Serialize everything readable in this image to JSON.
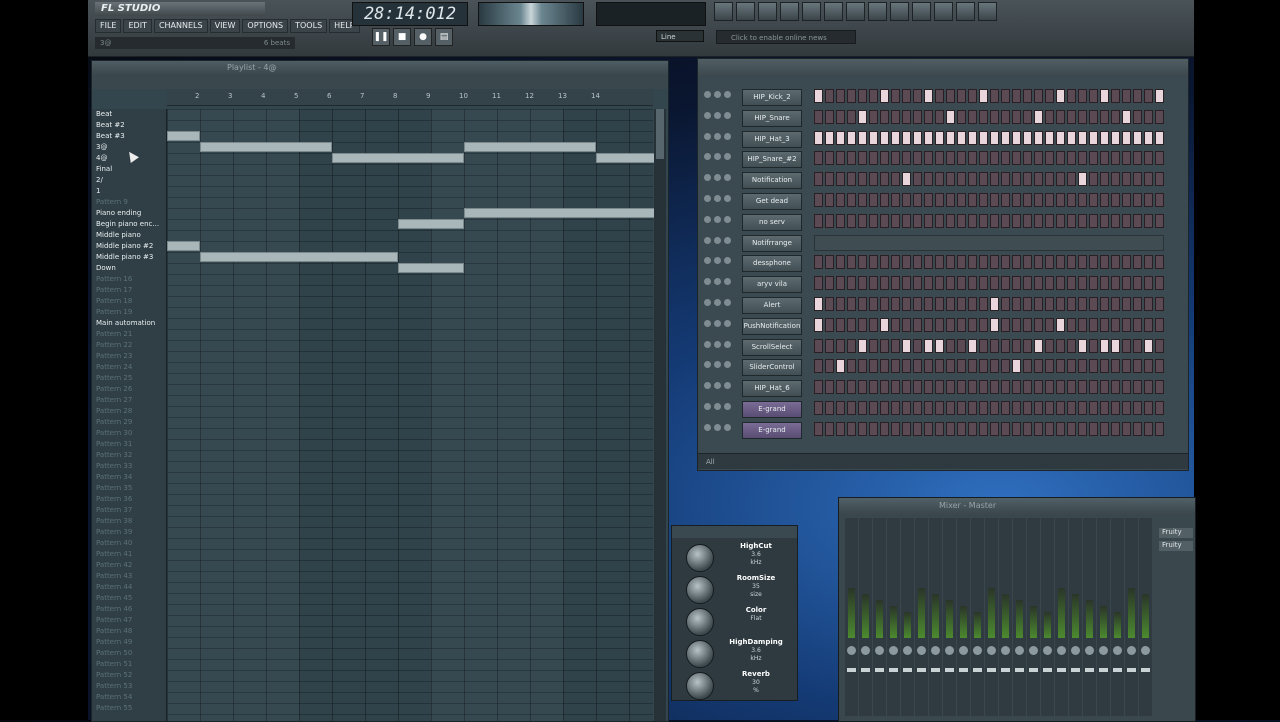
{
  "app": {
    "title": "FL STUDIO",
    "hint": "3@",
    "hint_right": "6 beats"
  },
  "menu": [
    "FILE",
    "EDIT",
    "CHANNELS",
    "VIEW",
    "OPTIONS",
    "TOOLS",
    "HELP"
  ],
  "time_display": "28:14:012",
  "news_text": "Click to enable online news",
  "line_label": "Line",
  "playlist": {
    "title": "Playlist - 4@",
    "ruler": [
      "2",
      "3",
      "4",
      "5",
      "6",
      "7",
      "8",
      "9",
      "10",
      "11",
      "12",
      "13",
      "14"
    ],
    "tracks": [
      {
        "label": "Beat",
        "named": true
      },
      {
        "label": "Beat #2",
        "named": true
      },
      {
        "label": "Beat #3",
        "named": true
      },
      {
        "label": "3@",
        "named": true
      },
      {
        "label": "4@",
        "named": true
      },
      {
        "label": "Final",
        "named": true
      },
      {
        "label": "2/",
        "named": true
      },
      {
        "label": "1",
        "named": true
      },
      {
        "label": "Pattern 9",
        "named": false
      },
      {
        "label": "Piano ending",
        "named": true
      },
      {
        "label": "Begin piano enc...",
        "named": true
      },
      {
        "label": "Middle piano",
        "named": true
      },
      {
        "label": "Middle piano #2",
        "named": true
      },
      {
        "label": "Middle piano #3",
        "named": true
      },
      {
        "label": "Down",
        "named": true
      },
      {
        "label": "Pattern 16",
        "named": false
      },
      {
        "label": "Pattern 17",
        "named": false
      },
      {
        "label": "Pattern 18",
        "named": false
      },
      {
        "label": "Pattern 19",
        "named": false
      },
      {
        "label": "Main automation",
        "named": true
      },
      {
        "label": "Pattern 21",
        "named": false
      },
      {
        "label": "Pattern 22",
        "named": false
      },
      {
        "label": "Pattern 23",
        "named": false
      },
      {
        "label": "Pattern 24",
        "named": false
      },
      {
        "label": "Pattern 25",
        "named": false
      },
      {
        "label": "Pattern 26",
        "named": false
      },
      {
        "label": "Pattern 27",
        "named": false
      },
      {
        "label": "Pattern 28",
        "named": false
      },
      {
        "label": "Pattern 29",
        "named": false
      },
      {
        "label": "Pattern 30",
        "named": false
      },
      {
        "label": "Pattern 31",
        "named": false
      },
      {
        "label": "Pattern 32",
        "named": false
      },
      {
        "label": "Pattern 33",
        "named": false
      },
      {
        "label": "Pattern 34",
        "named": false
      },
      {
        "label": "Pattern 35",
        "named": false
      },
      {
        "label": "Pattern 36",
        "named": false
      },
      {
        "label": "Pattern 37",
        "named": false
      },
      {
        "label": "Pattern 38",
        "named": false
      },
      {
        "label": "Pattern 39",
        "named": false
      },
      {
        "label": "Pattern 40",
        "named": false
      },
      {
        "label": "Pattern 41",
        "named": false
      },
      {
        "label": "Pattern 42",
        "named": false
      },
      {
        "label": "Pattern 43",
        "named": false
      },
      {
        "label": "Pattern 44",
        "named": false
      },
      {
        "label": "Pattern 45",
        "named": false
      },
      {
        "label": "Pattern 46",
        "named": false
      },
      {
        "label": "Pattern 47",
        "named": false
      },
      {
        "label": "Pattern 48",
        "named": false
      },
      {
        "label": "Pattern 49",
        "named": false
      },
      {
        "label": "Pattern 50",
        "named": false
      },
      {
        "label": "Pattern 51",
        "named": false
      },
      {
        "label": "Pattern 52",
        "named": false
      },
      {
        "label": "Pattern 53",
        "named": false
      },
      {
        "label": "Pattern 54",
        "named": false
      },
      {
        "label": "Pattern 55",
        "named": false
      }
    ],
    "clips": [
      {
        "track": 2,
        "start": 0,
        "len": 1
      },
      {
        "track": 3,
        "start": 1,
        "len": 4
      },
      {
        "track": 4,
        "start": 5,
        "len": 4
      },
      {
        "track": 3,
        "start": 9,
        "len": 4
      },
      {
        "track": 4,
        "start": 13,
        "len": 2
      },
      {
        "track": 9,
        "start": 9,
        "len": 6
      },
      {
        "track": 10,
        "start": 7,
        "len": 2
      },
      {
        "track": 12,
        "start": 0,
        "len": 1
      },
      {
        "track": 13,
        "start": 1,
        "len": 6
      },
      {
        "track": 14,
        "start": 7,
        "len": 2
      }
    ]
  },
  "sequencer": {
    "filter": "All",
    "channels": [
      {
        "name": "HIP_Kick_2",
        "steps": [
          1,
          0,
          0,
          0,
          0,
          0,
          1,
          0,
          0,
          0,
          1,
          0,
          0,
          0,
          0,
          1,
          0,
          0,
          0,
          0,
          0,
          0,
          1,
          0,
          0,
          0,
          1,
          0,
          0,
          0,
          0,
          1
        ]
      },
      {
        "name": "HIP_Snare",
        "steps": [
          0,
          0,
          0,
          0,
          1,
          0,
          0,
          0,
          0,
          0,
          0,
          0,
          1,
          0,
          0,
          0,
          0,
          0,
          0,
          0,
          1,
          0,
          0,
          0,
          0,
          0,
          0,
          0,
          1,
          0,
          0,
          0
        ]
      },
      {
        "name": "HIP_Hat_3",
        "steps": [
          1,
          1,
          1,
          1,
          1,
          1,
          1,
          1,
          1,
          1,
          1,
          1,
          1,
          1,
          1,
          1,
          1,
          1,
          1,
          1,
          1,
          1,
          1,
          1,
          1,
          1,
          1,
          1,
          1,
          1,
          1,
          1
        ]
      },
      {
        "name": "HIP_Snare_#2",
        "steps": [
          0,
          0,
          0,
          0,
          0,
          0,
          0,
          0,
          0,
          0,
          0,
          0,
          0,
          0,
          0,
          0,
          0,
          0,
          0,
          0,
          0,
          0,
          0,
          0,
          0,
          0,
          0,
          0,
          0,
          0,
          0,
          0
        ]
      },
      {
        "name": "Notification",
        "steps": [
          0,
          0,
          0,
          0,
          0,
          0,
          0,
          0,
          1,
          0,
          0,
          0,
          0,
          0,
          0,
          0,
          0,
          0,
          0,
          0,
          0,
          0,
          0,
          0,
          1,
          0,
          0,
          0,
          0,
          0,
          0,
          0
        ]
      },
      {
        "name": "Get dead",
        "steps": [
          0,
          0,
          0,
          0,
          0,
          0,
          0,
          0,
          0,
          0,
          0,
          0,
          0,
          0,
          0,
          0,
          0,
          0,
          0,
          0,
          0,
          0,
          0,
          0,
          0,
          0,
          0,
          0,
          0,
          0,
          0,
          0
        ]
      },
      {
        "name": "no serv",
        "steps": [
          0,
          0,
          0,
          0,
          0,
          0,
          0,
          0,
          0,
          0,
          0,
          0,
          0,
          0,
          0,
          0,
          0,
          0,
          0,
          0,
          0,
          0,
          0,
          0,
          0,
          0,
          0,
          0,
          0,
          0,
          0,
          0
        ]
      },
      {
        "name": "Notifrrange",
        "steps": [],
        "purple": false
      },
      {
        "name": "dessphone",
        "steps": [
          0,
          0,
          0,
          0,
          0,
          0,
          0,
          0,
          0,
          0,
          0,
          0,
          0,
          0,
          0,
          0,
          0,
          0,
          0,
          0,
          0,
          0,
          0,
          0,
          0,
          0,
          0,
          0,
          0,
          0,
          0,
          0
        ]
      },
      {
        "name": "aryv vila",
        "steps": [
          0,
          0,
          0,
          0,
          0,
          0,
          0,
          0,
          0,
          0,
          0,
          0,
          0,
          0,
          0,
          0,
          0,
          0,
          0,
          0,
          0,
          0,
          0,
          0,
          0,
          0,
          0,
          0,
          0,
          0,
          0,
          0
        ]
      },
      {
        "name": "Alert",
        "steps": [
          1,
          0,
          0,
          0,
          0,
          0,
          0,
          0,
          0,
          0,
          0,
          0,
          0,
          0,
          0,
          0,
          1,
          0,
          0,
          0,
          0,
          0,
          0,
          0,
          0,
          0,
          0,
          0,
          0,
          0,
          0,
          0
        ]
      },
      {
        "name": "PushNotification",
        "steps": [
          1,
          0,
          0,
          0,
          0,
          0,
          1,
          0,
          0,
          0,
          0,
          0,
          0,
          0,
          0,
          0,
          1,
          0,
          0,
          0,
          0,
          0,
          1,
          0,
          0,
          0,
          0,
          0,
          0,
          0,
          0,
          0
        ]
      },
      {
        "name": "ScrollSelect",
        "steps": [
          0,
          0,
          0,
          0,
          1,
          0,
          0,
          0,
          1,
          0,
          1,
          1,
          0,
          0,
          1,
          0,
          0,
          0,
          0,
          0,
          1,
          0,
          0,
          0,
          1,
          0,
          1,
          1,
          0,
          0,
          1,
          0
        ]
      },
      {
        "name": "SliderControl",
        "steps": [
          0,
          0,
          1,
          0,
          0,
          0,
          0,
          0,
          0,
          0,
          0,
          0,
          0,
          0,
          0,
          0,
          0,
          0,
          1,
          0,
          0,
          0,
          0,
          0,
          0,
          0,
          0,
          0,
          0,
          0,
          0,
          0
        ]
      },
      {
        "name": "HIP_Hat_6",
        "steps": [
          0,
          0,
          0,
          0,
          0,
          0,
          0,
          0,
          0,
          0,
          0,
          0,
          0,
          0,
          0,
          0,
          0,
          0,
          0,
          0,
          0,
          0,
          0,
          0,
          0,
          0,
          0,
          0,
          0,
          0,
          0,
          0
        ]
      },
      {
        "name": "E-grand",
        "steps": [
          0,
          0,
          0,
          0,
          0,
          0,
          0,
          0,
          0,
          0,
          0,
          0,
          0,
          0,
          0,
          0,
          0,
          0,
          0,
          0,
          0,
          0,
          0,
          0,
          0,
          0,
          0,
          0,
          0,
          0,
          0,
          0
        ],
        "purple": true
      },
      {
        "name": "E-grand",
        "steps": [
          0,
          0,
          0,
          0,
          0,
          0,
          0,
          0,
          0,
          0,
          0,
          0,
          0,
          0,
          0,
          0,
          0,
          0,
          0,
          0,
          0,
          0,
          0,
          0,
          0,
          0,
          0,
          0,
          0,
          0,
          0,
          0
        ],
        "purple": true
      }
    ]
  },
  "reverb": {
    "knobs": [
      {
        "label": "HighCut",
        "value": "3.6",
        "unit": "kHz"
      },
      {
        "label": "RoomSize",
        "value": "35",
        "unit": "size"
      },
      {
        "label": "Color",
        "value": "Flat",
        "unit": ""
      },
      {
        "label": "HighDamping",
        "value": "3.6",
        "unit": "kHz"
      },
      {
        "label": "Reverb",
        "value": "30",
        "unit": "%"
      }
    ]
  },
  "mixer": {
    "title": "Mixer - Master",
    "inserts": [
      "Fruity",
      "Fruity"
    ],
    "strip_count": 22
  }
}
